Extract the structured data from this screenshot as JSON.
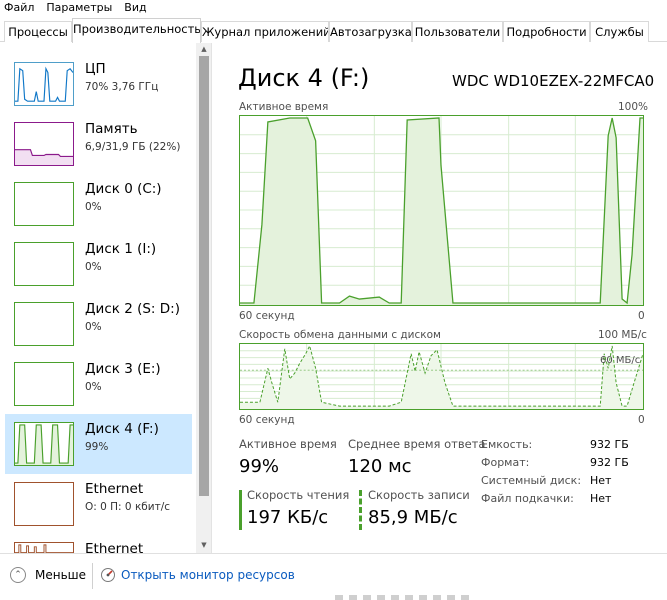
{
  "menu": [
    "Файл",
    "Параметры",
    "Вид"
  ],
  "tabs": [
    {
      "label": "Процессы",
      "active": false
    },
    {
      "label": "Производительность",
      "active": true
    },
    {
      "label": "Журнал приложений",
      "active": false
    },
    {
      "label": "Автозагрузка",
      "active": false
    },
    {
      "label": "Пользователи",
      "active": false
    },
    {
      "label": "Подробности",
      "active": false
    },
    {
      "label": "Службы",
      "active": false
    }
  ],
  "sidebar": {
    "items": [
      {
        "title": "ЦП",
        "subtitle": "70%  3,76 ГГц",
        "color": "#1178c8"
      },
      {
        "title": "Память",
        "subtitle": "6,9/31,9 ГБ (22%)",
        "color": "#8b1a8b"
      },
      {
        "title": "Диск 0 (C:)",
        "subtitle": "0%",
        "color": "#4aa02c"
      },
      {
        "title": "Диск 1 (I:)",
        "subtitle": "0%",
        "color": "#4aa02c"
      },
      {
        "title": "Диск 2 (S: D:)",
        "subtitle": "0%",
        "color": "#4aa02c"
      },
      {
        "title": "Диск 3 (E:)",
        "subtitle": "0%",
        "color": "#4aa02c"
      },
      {
        "title": "Диск 4 (F:)",
        "subtitle": "99%",
        "color": "#4aa02c",
        "selected": true
      },
      {
        "title": "Ethernet",
        "subtitle": "О: 0 П: 0 кбит/с",
        "color": "#a0522d"
      },
      {
        "title": "Ethernet",
        "subtitle": "",
        "color": "#a0522d"
      }
    ]
  },
  "detail": {
    "title": "Диск 4 (F:)",
    "model": "WDC WD10EZEX-22MFCA0",
    "graph1": {
      "label": "Активное время",
      "max": "100%",
      "xlabel": "60 секунд",
      "xend": "0"
    },
    "graph2": {
      "label": "Скорость обмена данными с диском",
      "max": "100 МБ/с",
      "mid": "60 МБ/с",
      "xlabel": "60 секунд",
      "xend": "0"
    },
    "stats": {
      "active_label": "Активное время",
      "active_value": "99%",
      "response_label": "Среднее время ответа",
      "response_value": "120 мс",
      "read_label": "Скорость чтения",
      "read_value": "197 КБ/с",
      "write_label": "Скорость записи",
      "write_value": "85,9 МБ/с"
    },
    "props": [
      {
        "label": "Емкость:",
        "value": "932 ГБ"
      },
      {
        "label": "Формат:",
        "value": "932 ГБ"
      },
      {
        "label": "Системный диск:",
        "value": "Нет"
      },
      {
        "label": "Файл подкачки:",
        "value": "Нет"
      }
    ],
    "accent": "#4aa02c"
  },
  "footer": {
    "fewer_label": "Меньше",
    "monitor_label": "Открыть монитор ресурсов"
  }
}
